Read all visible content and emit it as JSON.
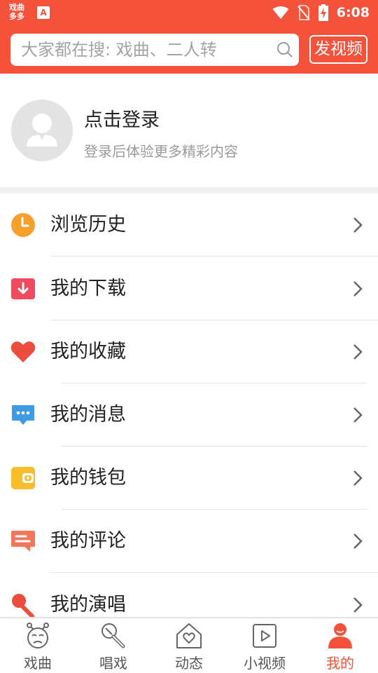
{
  "status_bar": {
    "app_logo": "戏曲多多",
    "notif_badge": "A",
    "time": "6:08"
  },
  "search": {
    "placeholder": "大家都在搜: 戏曲、二人转",
    "publish_label": "发视频"
  },
  "profile": {
    "title": "点击登录",
    "subtitle": "登录后体验更多精彩内容"
  },
  "menu": {
    "items": [
      {
        "label": "浏览历史",
        "icon": "clock-icon",
        "color": "#f5a12c"
      },
      {
        "label": "我的下载",
        "icon": "download-icon",
        "color": "#ef4a5e"
      },
      {
        "label": "我的收藏",
        "icon": "heart-icon",
        "color": "#ec4d3d"
      },
      {
        "label": "我的消息",
        "icon": "message-icon",
        "color": "#3f9ae6"
      },
      {
        "label": "我的钱包",
        "icon": "wallet-icon",
        "color": "#f7bd2a"
      },
      {
        "label": "我的评论",
        "icon": "comment-icon",
        "color": "#f0775a"
      },
      {
        "label": "我的演唱",
        "icon": "microphone-icon",
        "color": "#ec4d3d"
      }
    ]
  },
  "bottom_nav": {
    "items": [
      {
        "label": "戏曲",
        "icon": "opera-mask-icon"
      },
      {
        "label": "唱戏",
        "icon": "microphone-icon"
      },
      {
        "label": "动态",
        "icon": "house-heart-icon"
      },
      {
        "label": "小视频",
        "icon": "play-icon"
      },
      {
        "label": "我的",
        "icon": "user-icon",
        "active": true
      }
    ],
    "active_color": "#f4523b"
  },
  "colors": {
    "brand": "#f4523b"
  }
}
